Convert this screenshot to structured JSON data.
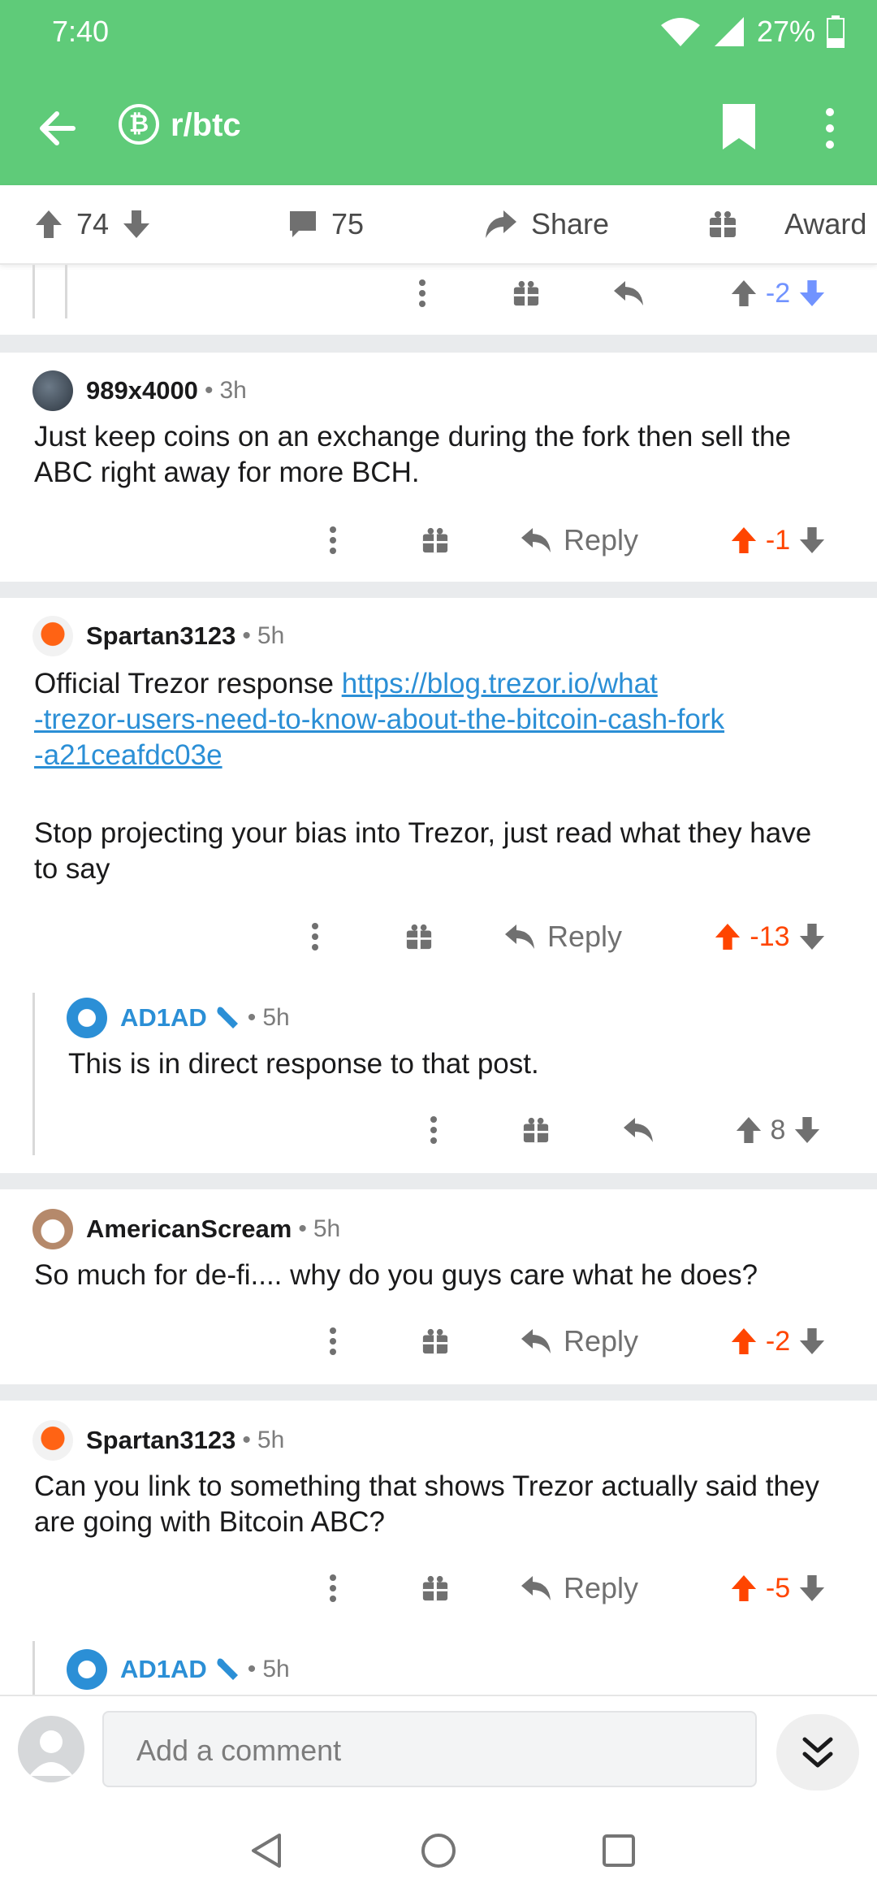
{
  "status": {
    "time": "7:40",
    "battery": "27%"
  },
  "header": {
    "subreddit": "r/btc",
    "sub_icon_glyph": "₿"
  },
  "post_actions": {
    "upvotes": "74",
    "comments": "75",
    "share": "Share",
    "award": "Award"
  },
  "top_partial": {
    "score": "-2"
  },
  "comments": [
    {
      "author": "989x4000",
      "time": "3h",
      "body": "Just keep coins on an exchange during the fork then sell the ABC right away for more BCH.",
      "reply": "Reply",
      "score": "-1"
    },
    {
      "author": "Spartan3123",
      "time": "5h",
      "body_prefix": "Official Trezor response ",
      "link_line1": "https://blog.trezor.io/what",
      "link_line2": "-trezor-users-need-to-know-about-the-bitcoin-cash-fork",
      "link_line3": "-a21ceafdc03e",
      "body_line2": "Stop projecting your bias into Trezor, just read what they have",
      "body_line3": "to say",
      "reply": "Reply",
      "score": "-13"
    },
    {
      "author": "AD1AD",
      "time": "5h",
      "body": "This is in direct response to that post.",
      "score": "8"
    },
    {
      "author": "AmericanScream",
      "time": "5h",
      "body": "So much for de-fi.... why do you guys care what he does?",
      "reply": "Reply",
      "score": "-2"
    },
    {
      "author": "Spartan3123",
      "time": "5h",
      "body": "Can you link to something that shows Trezor actually said they are going with Bitcoin ABC?",
      "reply": "Reply",
      "score": "-5"
    },
    {
      "author": "AD1AD",
      "time": "5h"
    }
  ],
  "composer": {
    "placeholder": "Add a comment"
  },
  "colors": {
    "accent": "#5fcb79",
    "orangered": "#ff4500",
    "periwinkle": "#7193ff",
    "link": "#2b8fd6"
  }
}
